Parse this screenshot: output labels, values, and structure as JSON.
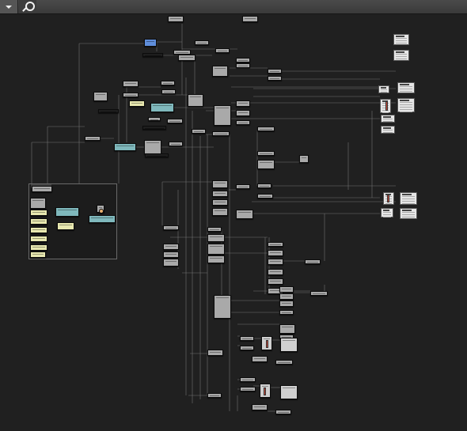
{
  "toolbar": {
    "dropdown_icon": "chevron-down-icon",
    "search_icon": "search-icon"
  },
  "canvas": {
    "background": "#202020",
    "wire_color": "#8a8a8a",
    "node_colors": {
      "default": "#a9a9a9",
      "dark": "#1e1e1e",
      "selected": "#5f8edb",
      "teal": "#7fb8bc",
      "note": "#e8e8b0",
      "light": "#d0d0d0"
    }
  }
}
